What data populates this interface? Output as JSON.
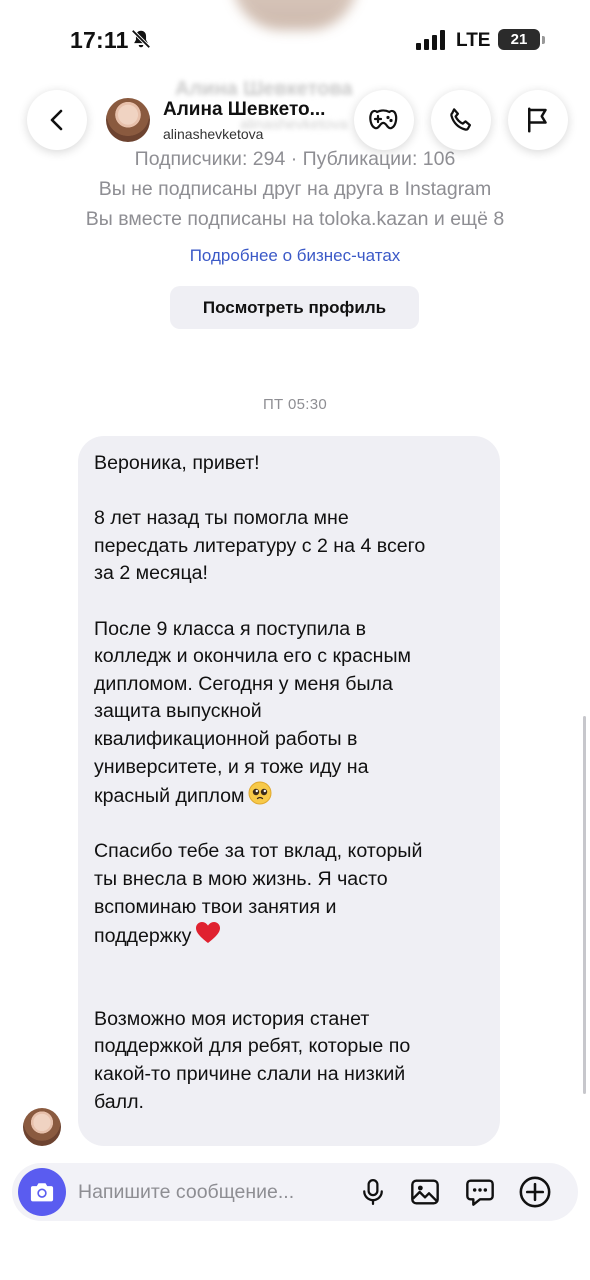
{
  "status_bar": {
    "time": "17:11",
    "network": "LTE",
    "battery": "21"
  },
  "background_profile": {
    "name": "Алина Шевкетова",
    "handle": "alinashevketova"
  },
  "header": {
    "name": "Алина Шевкето...",
    "handle": "alinashevketova"
  },
  "profile_info": {
    "stats": "Подписчики: 294 · Публикации: 106",
    "not_following": "Вы не подписаны друг на друга в Instagram",
    "mutual": "Вы вместе подписаны на toloka.kazan и ещё 8",
    "business_link": "Подробнее о бизнес-чатах",
    "view_profile": "Посмотреть профиль"
  },
  "conversation": {
    "timestamp": "ПТ 05:30",
    "message": {
      "lines": [
        "Вероника, привет!",
        "",
        "8 лет назад ты помогла мне",
        "пересдать литературу с 2 на 4 всего",
        "за 2 месяца!",
        "",
        "После 9 класса я поступила в",
        "колледж и окончила его с красным",
        "дипломом. Сегодня у меня была",
        "защита выпускной",
        "квалификационной работы в",
        "университете, и я тоже иду на",
        "красный диплом",
        "",
        "Спасибо тебе за тот вклад, который",
        "ты внесла в мою жизнь. Я часто",
        "вспоминаю твои занятия и",
        "поддержку",
        "",
        "",
        "Возможно моя история станет",
        "поддержкой для ребят, которые по",
        "какой-то причине слали на низкий",
        "балл."
      ]
    }
  },
  "composer": {
    "placeholder": "Напишите сообщение..."
  },
  "colors": {
    "accent": "#5a5cf0",
    "link": "#3b59c7",
    "bubble": "#efeff4",
    "secondary_text": "#8e8e93"
  },
  "icons": {
    "back": "chevron-left-icon",
    "games": "game-controller-icon",
    "call": "phone-icon",
    "report": "flag-icon",
    "camera": "camera-icon",
    "mic": "microphone-icon",
    "gallery": "image-icon",
    "sticker": "chat-bubble-icon",
    "add": "plus-circle-icon"
  }
}
